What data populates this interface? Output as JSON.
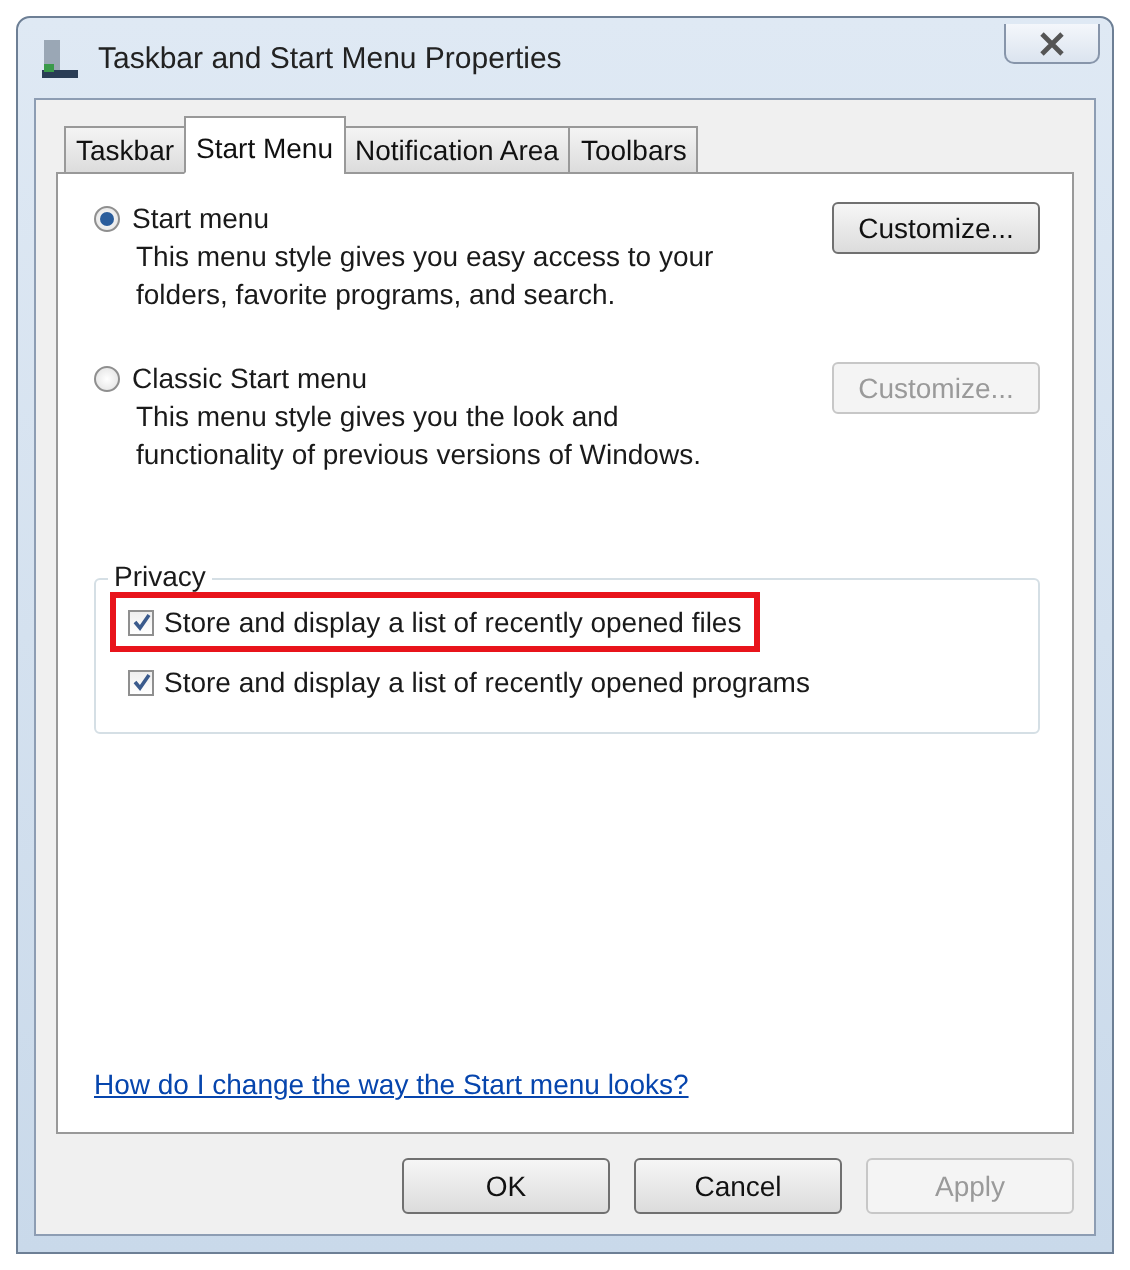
{
  "window": {
    "title": "Taskbar and Start Menu Properties"
  },
  "tabs": [
    {
      "label": "Taskbar",
      "selected": false
    },
    {
      "label": "Start Menu",
      "selected": true
    },
    {
      "label": "Notification Area",
      "selected": false
    },
    {
      "label": "Toolbars",
      "selected": false
    }
  ],
  "styles": [
    {
      "label": "Start menu",
      "selected": true,
      "description": "This menu style gives you easy access to your folders, favorite programs, and search.",
      "button": {
        "label": "Customize...",
        "disabled": false
      }
    },
    {
      "label": "Classic Start menu",
      "selected": false,
      "description": "This menu style gives you the look and functionality of previous versions of Windows.",
      "button": {
        "label": "Customize...",
        "disabled": true
      }
    }
  ],
  "privacy": {
    "title": "Privacy",
    "options": [
      {
        "label": "Store and display a list of recently opened files",
        "checked": true,
        "highlighted": true
      },
      {
        "label": "Store and display a list of recently opened programs",
        "checked": true,
        "highlighted": false
      }
    ]
  },
  "help_link": "How do I change the way the Start menu looks?",
  "buttons": [
    {
      "label": "OK",
      "disabled": false
    },
    {
      "label": "Cancel",
      "disabled": false
    },
    {
      "label": "Apply",
      "disabled": true
    }
  ]
}
